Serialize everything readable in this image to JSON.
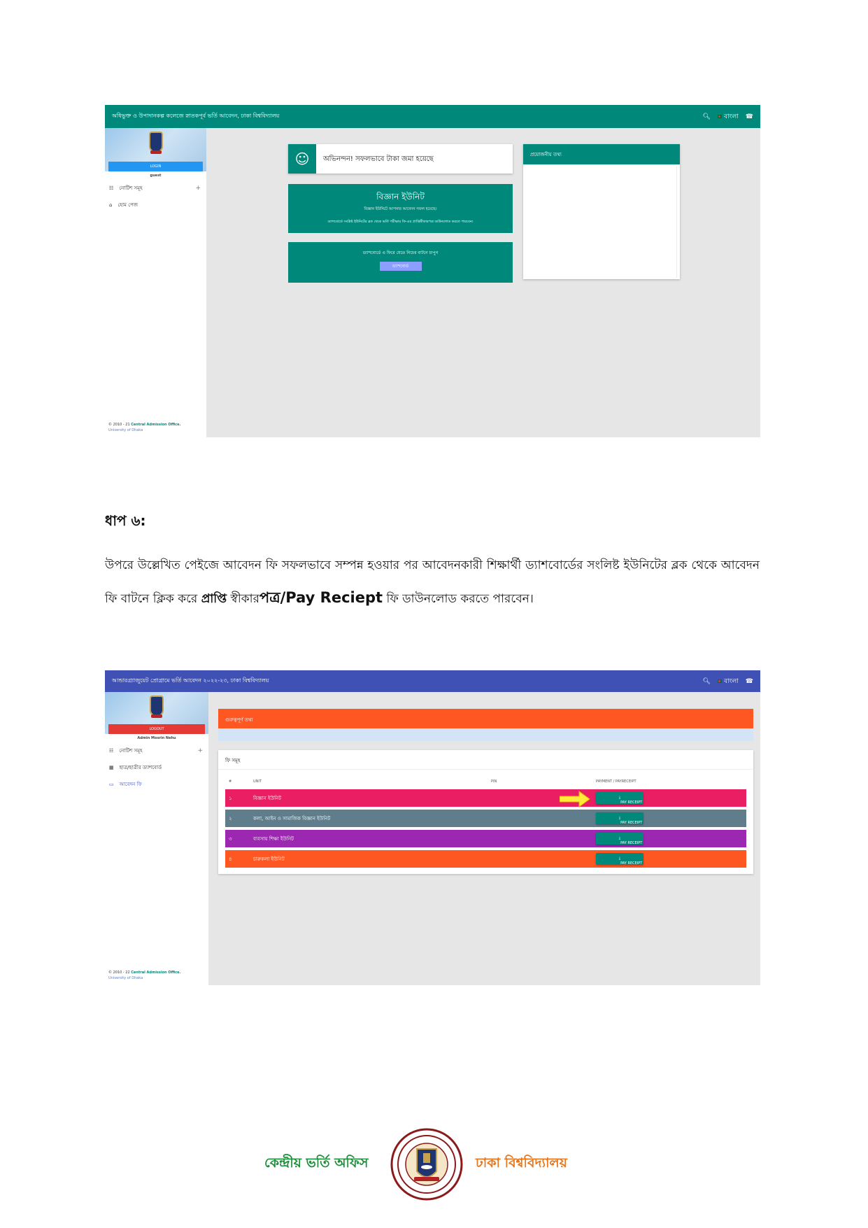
{
  "screenshot1": {
    "title": "অধিভুক্ত ও উপাদানকল্প কলেজে স্নাতকপূর্ব ভর্তি আবেদন, ঢাকা বিশ্ববিদ্যালয়",
    "lang": "বাংলা",
    "login_label": "LOGIN",
    "user": "guest",
    "menu": [
      "নোটিশ সমূহ",
      "হোম পেজ"
    ],
    "success_msg": "অভিনন্দন! সফলভাবে টাকা জমা হয়েছে",
    "unit_title": "বিজ্ঞান ইউনিট",
    "unit_sub": "বিজ্ঞান ইউনিটে আপনার আবেদন সফল হয়েছে।",
    "unit_note": "ড্যাশবোর্ডে সংশ্লিষ্ট ইউনিটের ব্লক থেকে ভর্তি পরীক্ষার ফি-এর প্রাপ্তিস্বীকারপত্র ডাউনলোড করতে পারবেন।",
    "back_text": "ড্যাশবোর্ডে এ ফিরে যেতে নিচের বাটনে চাপুন",
    "dashboard_btn": "ড্যাশবোর্ড",
    "info_panel_title": "প্রয়োজনীয় তথ্য",
    "footer_line1": "© 2010 - 21 ",
    "footer_brand": "Central Admission Office.",
    "footer_line2": "University of Dhaka"
  },
  "step": {
    "heading": "ধাপ ৬:",
    "para_part1": "উপরে উল্লেখিত পেইজে আবেদন ফি সফলভাবে সম্পন্ন হওয়ার পর আবেদনকারী শিক্ষার্থী ড্যাশবোর্ডের সংলিষ্ট ইউনিটের ব্লক থেকে আবেদন ফি  বাটনে ক্লিক করে ",
    "para_bold1": "প্রাপ্তি",
    "para_part2": " স্বীকার",
    "para_bold2": "পত্র/Pay Reciept",
    "para_part3": " ফি ডাউনলোড করতে পারবেন।"
  },
  "screenshot2": {
    "title": "আন্ডারগ্র্যাজুয়েট প্রোগ্রামে ভর্তি আবেদন ২০২২-২৩, ঢাকা বিশ্ববিদ্যালয়",
    "lang": "বাংলা",
    "logout_label": "LOGOUT",
    "user": "Admin Mosrin Nehu",
    "menu": [
      "নোটিশ সমূহ",
      "ছাত্র/ছাত্রীর ড্যাশবোর্ড",
      "আবেদন ফি"
    ],
    "important_title": "গুরুত্বপূর্ণ তথ্য",
    "fees_title": "ফি সমূহ",
    "columns": [
      "#",
      "UNIT",
      "PIN",
      "PAYMENT / PAYRECEIPT"
    ],
    "rows": [
      {
        "num": "১",
        "unit": "বিজ্ঞান ইউনিট",
        "btn": "PAY RECEIPT",
        "color": "#e91e63"
      },
      {
        "num": "২",
        "unit": "কলা, আইন ও সামাজিক বিজ্ঞান ইউনিট",
        "btn": "PAY RECEIPT",
        "color": "#607d8b"
      },
      {
        "num": "৩",
        "unit": "ব্যবসায় শিক্ষা ইউনিট",
        "btn": "PAY RECEIPT",
        "color": "#9c27b0"
      },
      {
        "num": "৪",
        "unit": "চারুকলা ইউনিট",
        "btn": "PAY RECEIPT",
        "color": "#ff5722"
      }
    ],
    "footer_line1": "© 2010 - 22 ",
    "footer_brand": "Central Admission Office.",
    "footer_line2": "University of Dhaka"
  },
  "page_footer": {
    "left": "কেন্দ্রীয় ভর্তি অফিস",
    "right": "ঢাকা বিশ্ববিদ্যালয়"
  },
  "colors": {
    "teal": "#00897b",
    "indigo": "#3f51b5",
    "orange": "#ff5722",
    "logout_red": "#e53935",
    "login_blue": "#2196f3",
    "footer_green": "#1b8f3a",
    "footer_orange": "#e8751a"
  }
}
